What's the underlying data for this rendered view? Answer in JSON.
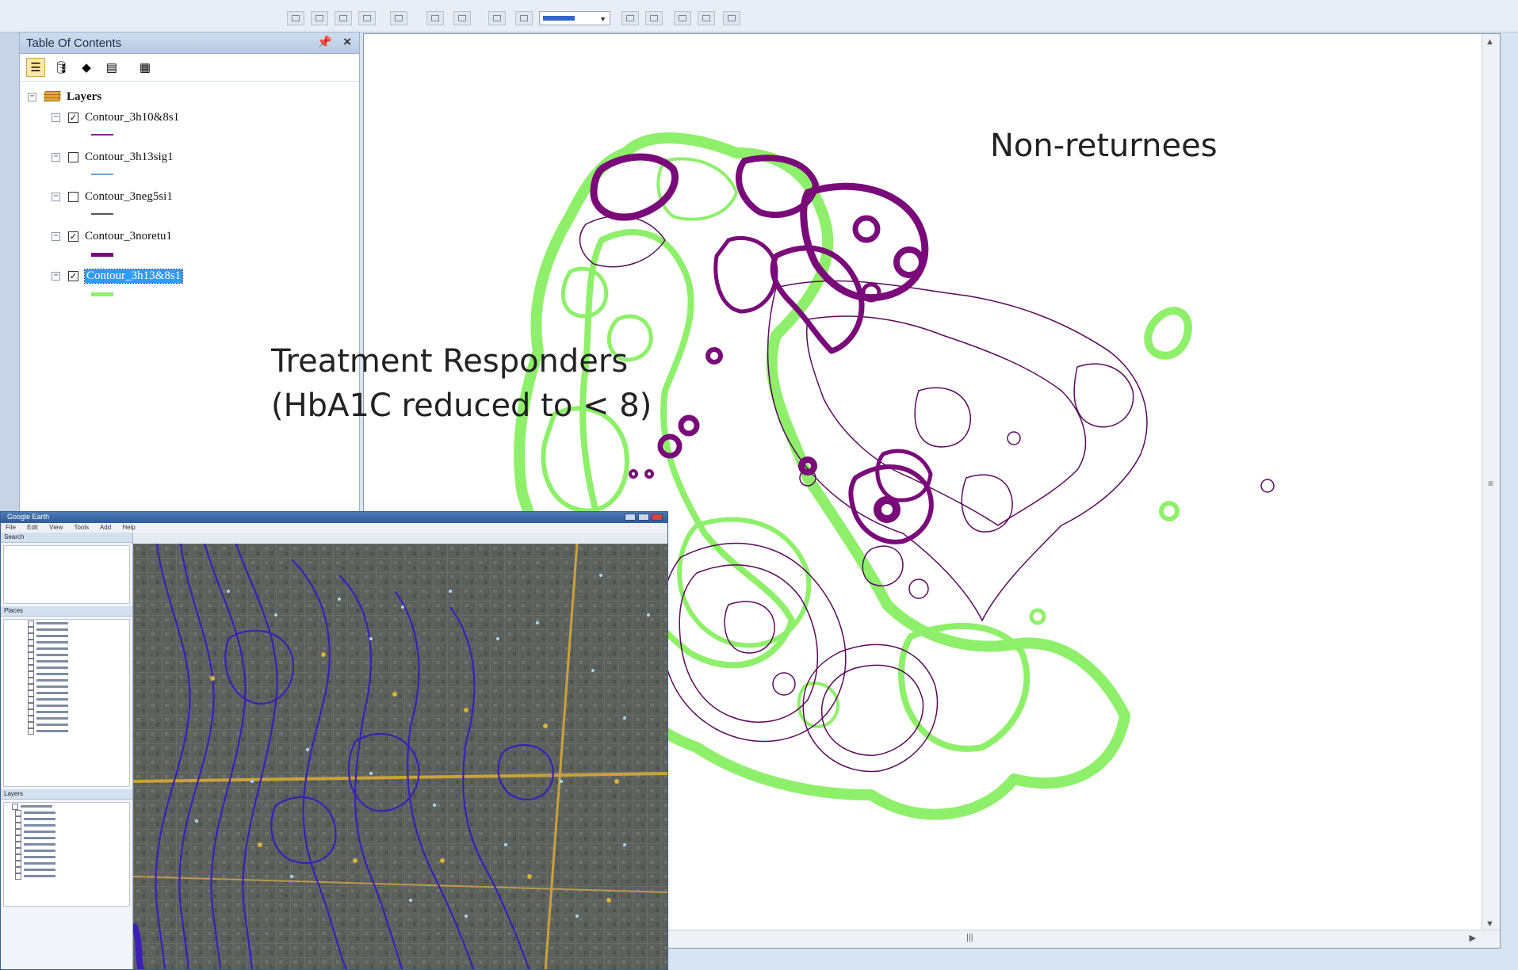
{
  "toc": {
    "title": "Table Of Contents",
    "root_label": "Layers",
    "layers": [
      {
        "label": "Contour_3h10&8s1",
        "checked": true,
        "swatch": "#8a2090",
        "selected": false
      },
      {
        "label": "Contour_3h13sig1",
        "checked": false,
        "swatch": "#6aa4d8",
        "selected": false
      },
      {
        "label": "Contour_3neg5si1",
        "checked": false,
        "swatch": "#555555",
        "selected": false
      },
      {
        "label": "Contour_3noretu1",
        "checked": true,
        "swatch": "#7a0a7a",
        "selected": false
      },
      {
        "label": "Contour_3h13&8s1",
        "checked": true,
        "swatch": "#8ef06a",
        "selected": true
      }
    ],
    "check_mark": "✓",
    "icons": [
      "list-by-drawing-order-icon",
      "list-by-source-icon",
      "list-by-visibility-icon",
      "list-by-selection-icon",
      "options-icon"
    ]
  },
  "map": {
    "label_nonreturnees": "Non-returnees",
    "label_responders_line1": "Treatment Responders",
    "label_responders_line2": "(HbA1C reduced to < 8)",
    "colors": {
      "green": "#8ef06a",
      "purple": "#7a0a7a",
      "thin": "#5a0a5a"
    }
  },
  "google_earth": {
    "title": "Google Earth",
    "menu": [
      "File",
      "Edit",
      "View",
      "Tools",
      "Add",
      "Help"
    ],
    "panels": [
      "Search",
      "Places",
      "Layers"
    ],
    "contour_color": "#3b1fb8"
  }
}
